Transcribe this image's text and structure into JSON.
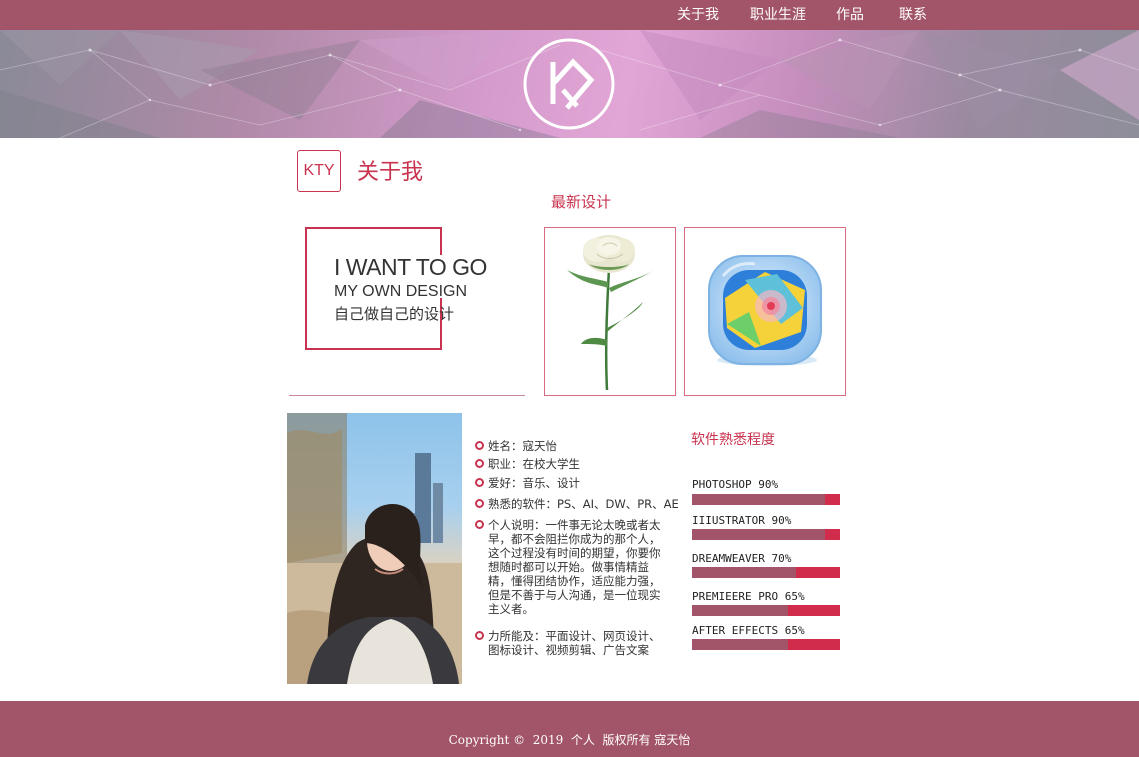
{
  "nav": {
    "items": [
      "关于我",
      "职业生涯",
      "作品",
      "联系"
    ]
  },
  "logo": {
    "icon": "kty-monogram-logo"
  },
  "about": {
    "badge": "KTY",
    "title": "关于我"
  },
  "slogan": {
    "line1": "I WANT TO GO",
    "line2": "MY OWN DESIGN",
    "line3": "自己做自己的设计"
  },
  "latest": {
    "title": "最新设计",
    "items": [
      {
        "icon": "white-rose-image"
      },
      {
        "icon": "map-app-icon"
      }
    ]
  },
  "profile": {
    "photo": "portrait-photo",
    "items": [
      "姓名：寇天怡",
      "职业：在校大学生",
      "爱好：音乐、设计",
      "熟悉的软件：PS、AI、DW、PR、AE",
      "个人说明：一件事无论太晚或者太\n早，都不会阻拦你成为的那个人，\n这个过程没有时间的期望，你要你\n想随时都可以开始。做事情精益\n精，懂得团结协作，适应能力强，\n但是不善于与人沟通，是一位现实\n主义者。",
      "力所能及：平面设计、网页设计、\n图标设计、视频剪辑、广告文案"
    ]
  },
  "skills": {
    "title": "软件熟悉程度",
    "items": [
      {
        "label": "PHOTOSHOP 90%",
        "percent": 90
      },
      {
        "label": "IIIUSTRATOR 90%",
        "percent": 90
      },
      {
        "label": "DREAMWEAVER 70%",
        "percent": 70
      },
      {
        "label": "PREMIEERE PRO 65%",
        "percent": 65
      },
      {
        "label": "AFTER EFFECTS 65%",
        "percent": 65
      }
    ]
  },
  "footer": {
    "text": "Copyright ©  2019  个人  版权所有 寇天怡"
  },
  "colors": {
    "brand": "#a25568",
    "accent": "#c9334f",
    "bar": "#d12c4b"
  }
}
